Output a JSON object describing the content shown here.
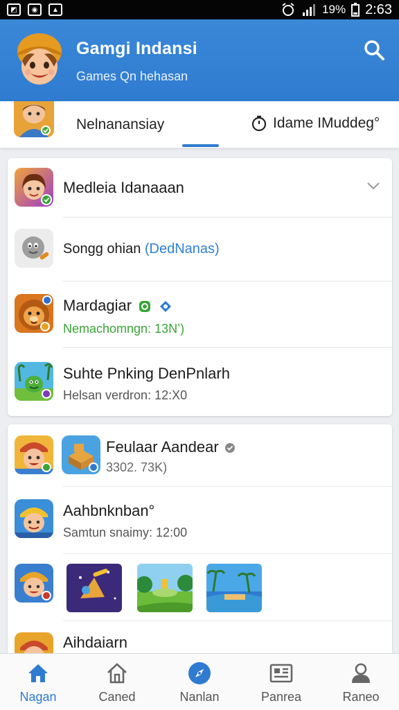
{
  "status_bar": {
    "battery": "19%",
    "time": "2:63"
  },
  "header": {
    "title": "Gamgi Indansi",
    "subtitle": "Games Qn hehasan"
  },
  "tabs": [
    {
      "label": "Nelnanansiay"
    },
    {
      "label": "Idame IMuddeg°"
    }
  ],
  "card1": {
    "rows": [
      {
        "title": "Medleia Idanaaan"
      },
      {
        "title_main": "Songg ohian",
        "title_link": "(DedNanas)"
      },
      {
        "title": "Mardagiar",
        "subtitle": "Nemachomngn: 13N’)"
      },
      {
        "title": "Suhte Pnking DenPnlarh",
        "subtitle": "Helsan verdron: 12:X0"
      }
    ]
  },
  "card2": {
    "rows": [
      {
        "title": "Feulaar Aandear",
        "subtitle": "3302. 73K)"
      },
      {
        "title": "Aahbnknban°",
        "subtitle": "Samtun snaimy: 12:00"
      },
      {
        "title": "Aihdaiarn"
      }
    ]
  },
  "bottom_nav": [
    {
      "label": "Nagan",
      "icon": "home-icon",
      "active": true
    },
    {
      "label": "Caned",
      "icon": "house-outline-icon",
      "active": false
    },
    {
      "label": "Nanlan",
      "icon": "compass-icon",
      "active": false
    },
    {
      "label": "Panrea",
      "icon": "news-icon",
      "active": false
    },
    {
      "label": "Raneo",
      "icon": "profile-icon",
      "active": false
    }
  ],
  "colors": {
    "primary": "#2f7bd0",
    "green": "#3aa536",
    "text": "#1c1c1c"
  }
}
